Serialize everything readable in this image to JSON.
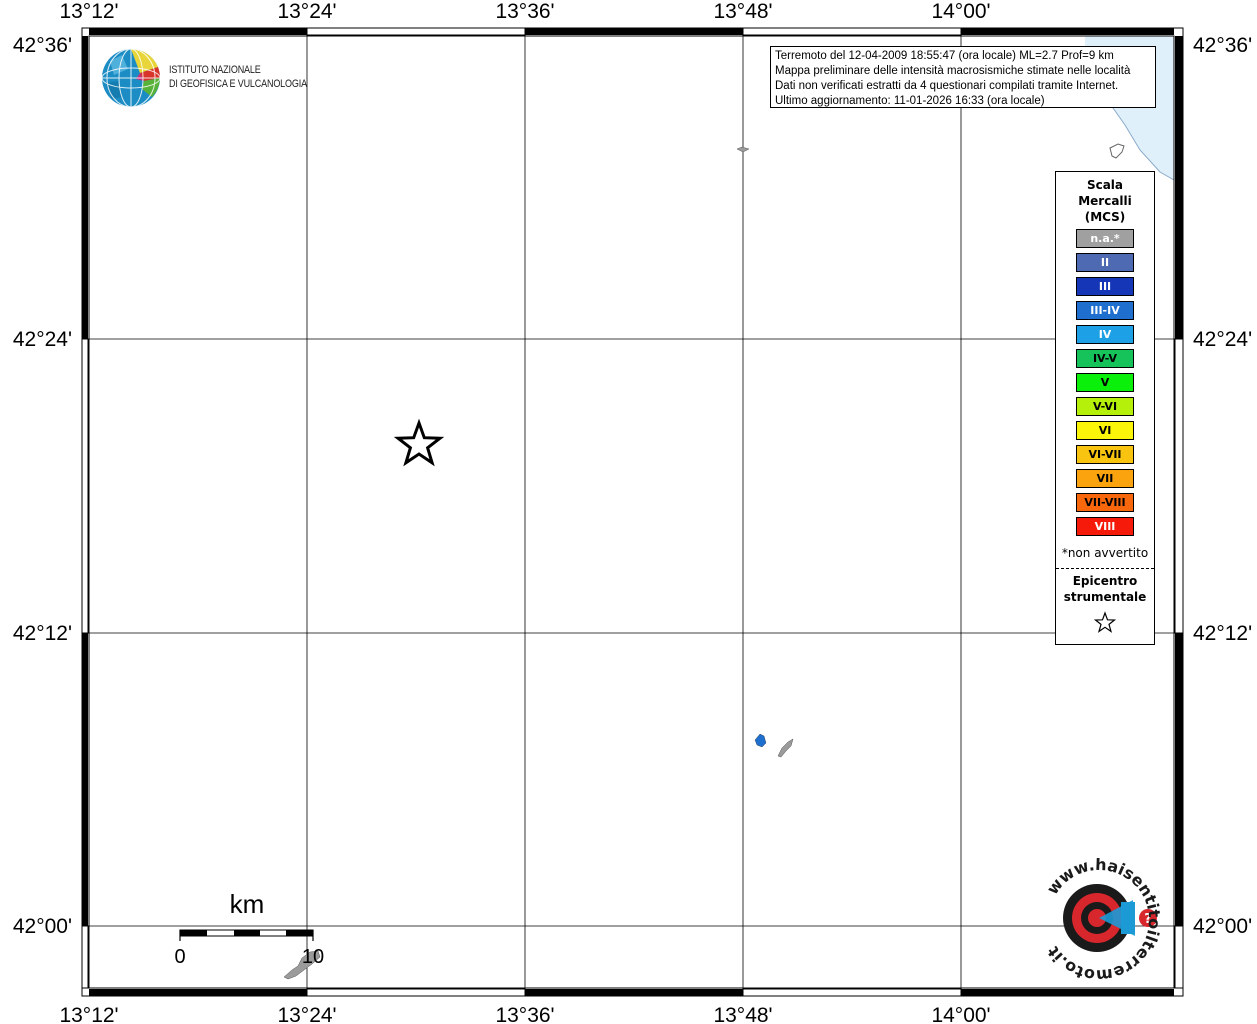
{
  "map": {
    "longitude_labels": [
      "13°12'",
      "13°24'",
      "13°36'",
      "13°48'",
      "14°00'"
    ],
    "latitude_labels": [
      "42°36'",
      "42°24'",
      "42°12'",
      "42°00'"
    ],
    "colors": {
      "sea": "#dff0fb",
      "land": "#ffffff",
      "epicenter_star": "#000000"
    },
    "epicenter": {
      "symbol": "star-icon"
    },
    "reported_localities": [
      {
        "intensity": "III-IV",
        "color": "#1f6fcf"
      },
      {
        "intensity": "n.a.*",
        "color": "#9b9b9b"
      }
    ]
  },
  "info_box": {
    "lines": [
      "Terremoto del 12-04-2009 18:55:47 (ora locale) ML=2.7 Prof=9 km",
      "Mappa preliminare delle intensità macrosismiche stimate nelle località",
      "Dati non verificati estratti da 4 questionari compilati tramite Internet.",
      "Ultimo aggiornamento: 11-01-2026 16:33 (ora locale)"
    ]
  },
  "legend": {
    "title_lines": [
      "Scala",
      "Mercalli",
      "(MCS)"
    ],
    "items": [
      {
        "label": "n.a.*",
        "color": "#a0a0a0",
        "text_color": "light"
      },
      {
        "label": "II",
        "color": "#4d6ab3",
        "text_color": "light"
      },
      {
        "label": "III",
        "color": "#1636b8",
        "text_color": "light"
      },
      {
        "label": "III-IV",
        "color": "#1f6fcf",
        "text_color": "light"
      },
      {
        "label": "IV",
        "color": "#1ea0e6",
        "text_color": "light"
      },
      {
        "label": "IV-V",
        "color": "#16c25a",
        "text_color": "dark"
      },
      {
        "label": "V",
        "color": "#0af00a",
        "text_color": "dark"
      },
      {
        "label": "V-VI",
        "color": "#b5f00a",
        "text_color": "dark"
      },
      {
        "label": "VI",
        "color": "#fbf50a",
        "text_color": "dark"
      },
      {
        "label": "VI-VII",
        "color": "#f9c40f",
        "text_color": "dark"
      },
      {
        "label": "VII",
        "color": "#faa30f",
        "text_color": "dark"
      },
      {
        "label": "VII-VIII",
        "color": "#f8670c",
        "text_color": "dark"
      },
      {
        "label": "VIII",
        "color": "#f51a0a",
        "text_color": "light"
      }
    ],
    "note": "*non avvertito",
    "epicenter_label_lines": [
      "Epicentro",
      "strumentale"
    ]
  },
  "logos": {
    "ingv_lines": [
      "ISTITUTO NAZIONALE",
      "DI GEOFISICA E VULCANOLOGIA"
    ],
    "haisentito_text": "www.haisentitoilterremoto.it",
    "haisentito_mark": "?"
  },
  "scale_bar": {
    "unit": "km",
    "tick_labels": [
      "0",
      "10"
    ]
  }
}
